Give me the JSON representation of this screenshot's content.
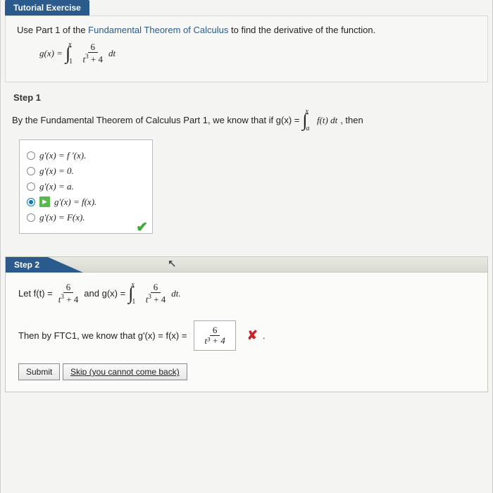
{
  "header": {
    "title": "Tutorial Exercise"
  },
  "problem": {
    "pre": "Use Part 1 of the ",
    "link": "Fundamental Theorem of Calculus",
    "post": " to find the derivative of the function.",
    "g_label": "g(x) = ",
    "int_lower": "1",
    "int_upper": "x",
    "frac_num": "6",
    "frac_den_t": "t",
    "frac_den_exp": "3",
    "frac_den_plus": " + 4",
    "dt": " dt"
  },
  "step1": {
    "label": "Step 1",
    "text_pre": "By the Fundamental Theorem of Calculus Part 1, we know that if  g(x) = ",
    "int_lower": "a",
    "int_upper": "x",
    "integrand": "f(t) dt",
    "text_post": ",  then",
    "options": [
      "g'(x) = f '(x).",
      "g'(x) = 0.",
      "g'(x) = a.",
      "g'(x) = f(x).",
      "g'(x) = F(x)."
    ],
    "selected_index": 3
  },
  "step2": {
    "label": "Step 2",
    "let_pre": "Let  f(t) = ",
    "and_text": "  and  g(x) = ",
    "dt": " dt.",
    "then_text": "Then by FTC1, we know that  g'(x) = f(x) = ",
    "answer_num": "6",
    "answer_den": "t³ + 4",
    "answer_correct": false,
    "buttons": {
      "submit": "Submit",
      "skip": "Skip (you cannot come back)"
    }
  }
}
